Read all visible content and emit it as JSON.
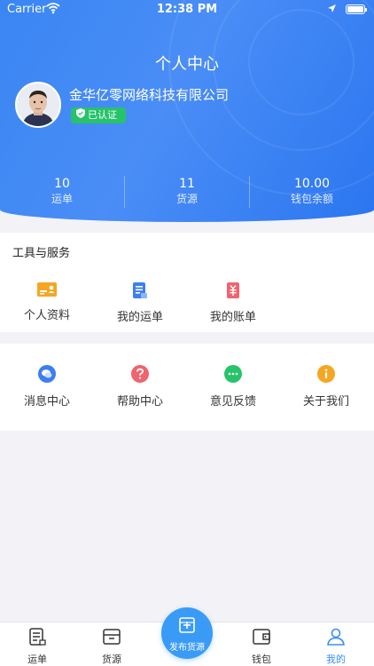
{
  "status_bar": {
    "carrier": "Carrier",
    "time": "12:38 PM"
  },
  "profile": {
    "page_title": "个人中心",
    "company_name": "金华亿零网络科技有限公司",
    "verified_label": "已认证"
  },
  "stats": [
    {
      "value": "10",
      "label": "运单"
    },
    {
      "value": "11",
      "label": "货源"
    },
    {
      "value": "10.00",
      "label": "钱包余额"
    }
  ],
  "tools": {
    "title": "工具与服务",
    "items": [
      {
        "label": "个人资料",
        "icon": "id-card-icon"
      },
      {
        "label": "我的运单",
        "icon": "waybill-icon"
      },
      {
        "label": "我的账单",
        "icon": "bill-icon"
      }
    ]
  },
  "more": {
    "items": [
      {
        "label": "消息中心",
        "icon": "message-icon"
      },
      {
        "label": "帮助中心",
        "icon": "help-icon"
      },
      {
        "label": "意见反馈",
        "icon": "feedback-icon"
      },
      {
        "label": "关于我们",
        "icon": "info-icon"
      }
    ]
  },
  "tabbar": {
    "items": [
      {
        "label": "运单",
        "icon": "waybill-tab-icon",
        "active": false
      },
      {
        "label": "货源",
        "icon": "cargo-tab-icon",
        "active": false
      },
      {
        "label": "钱包",
        "icon": "wallet-tab-icon",
        "active": false
      },
      {
        "label": "我的",
        "icon": "profile-tab-icon",
        "active": true
      }
    ],
    "publish_label": "发布货源"
  },
  "colors": {
    "primary": "#3a86f3",
    "tab_active": "#3a8ef6",
    "verified": "#27c36a",
    "id_card": "#f5a623",
    "waybill": "#3d7ef0",
    "bill": "#f0646e",
    "message": "#3d7ef0",
    "help": "#f0646e",
    "feedback": "#27c36a",
    "info": "#f5a623"
  }
}
